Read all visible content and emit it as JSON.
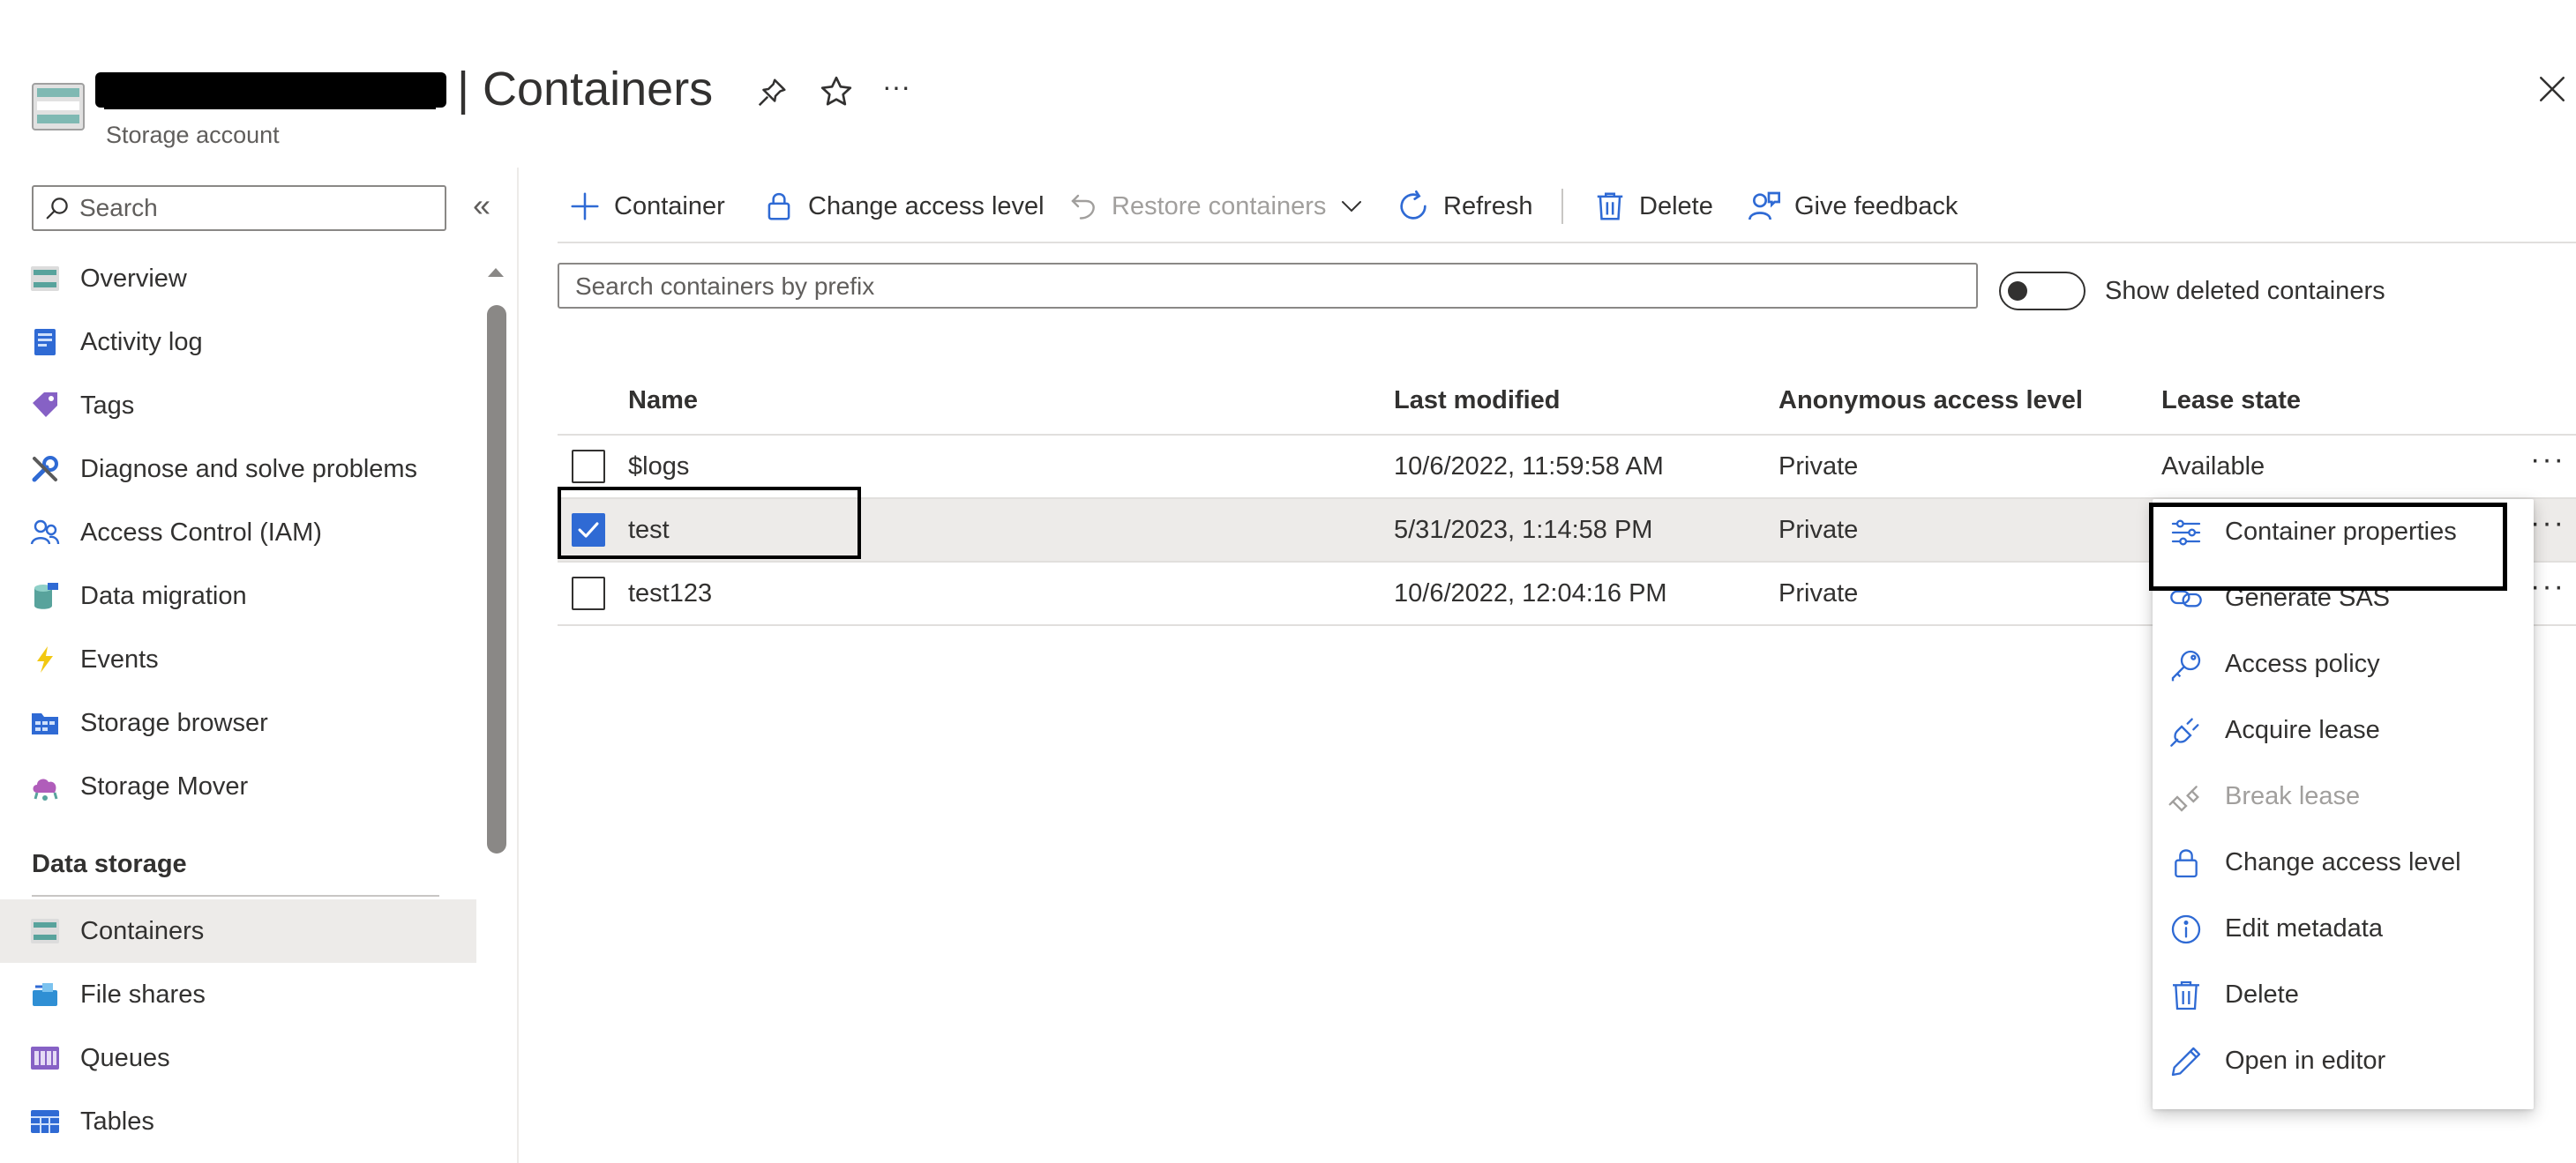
{
  "header": {
    "title_suffix": "| Containers",
    "subtitle": "Storage account",
    "more_label": "···"
  },
  "sidebar": {
    "search_placeholder": "Search",
    "collapse_label": "«",
    "items": [
      {
        "label": "Overview",
        "icon": "overview-icon"
      },
      {
        "label": "Activity log",
        "icon": "activity-log-icon"
      },
      {
        "label": "Tags",
        "icon": "tag-icon"
      },
      {
        "label": "Diagnose and solve problems",
        "icon": "wrench-icon"
      },
      {
        "label": "Access Control (IAM)",
        "icon": "people-icon"
      },
      {
        "label": "Data migration",
        "icon": "data-migration-icon"
      },
      {
        "label": "Events",
        "icon": "lightning-icon"
      },
      {
        "label": "Storage browser",
        "icon": "storage-browser-icon"
      },
      {
        "label": "Storage Mover",
        "icon": "cloud-icon"
      }
    ],
    "section_title": "Data storage",
    "data_storage_items": [
      {
        "label": "Containers",
        "icon": "containers-icon",
        "selected": true
      },
      {
        "label": "File shares",
        "icon": "file-shares-icon"
      },
      {
        "label": "Queues",
        "icon": "queues-icon"
      },
      {
        "label": "Tables",
        "icon": "tables-icon"
      }
    ]
  },
  "toolbar": {
    "add_container": "Container",
    "change_access_level": "Change access level",
    "restore_containers": "Restore containers",
    "refresh": "Refresh",
    "delete": "Delete",
    "give_feedback": "Give feedback"
  },
  "filter": {
    "search_placeholder": "Search containers by prefix",
    "toggle_label": "Show deleted containers",
    "toggle_on": false
  },
  "table": {
    "columns": [
      "Name",
      "Last modified",
      "Anonymous access level",
      "Lease state"
    ],
    "rows": [
      {
        "name": "$logs",
        "modified": "10/6/2022, 11:59:58 AM",
        "access": "Private",
        "lease": "Available",
        "checked": false
      },
      {
        "name": "test",
        "modified": "5/31/2023, 1:14:58 PM",
        "access": "Private",
        "lease": "",
        "checked": true
      },
      {
        "name": "test123",
        "modified": "10/6/2022, 12:04:16 PM",
        "access": "Private",
        "lease": "",
        "checked": false
      }
    ],
    "row_more_label": "···"
  },
  "context_menu": {
    "items": [
      {
        "label": "Container properties",
        "icon": "properties-icon"
      },
      {
        "label": "Generate SAS",
        "icon": "link-icon"
      },
      {
        "label": "Access policy",
        "icon": "key-icon"
      },
      {
        "label": "Acquire lease",
        "icon": "plug-icon"
      },
      {
        "label": "Break lease",
        "icon": "broken-plug-icon",
        "disabled": true
      },
      {
        "label": "Change access level",
        "icon": "lock-icon"
      },
      {
        "label": "Edit metadata",
        "icon": "info-icon"
      },
      {
        "label": "Delete",
        "icon": "trash-icon"
      },
      {
        "label": "Open in editor",
        "icon": "pencil-icon"
      }
    ]
  },
  "colors": {
    "accent": "#2f6ad4",
    "selected_bg": "#edebe9",
    "disabled_text": "#a19f9d"
  }
}
